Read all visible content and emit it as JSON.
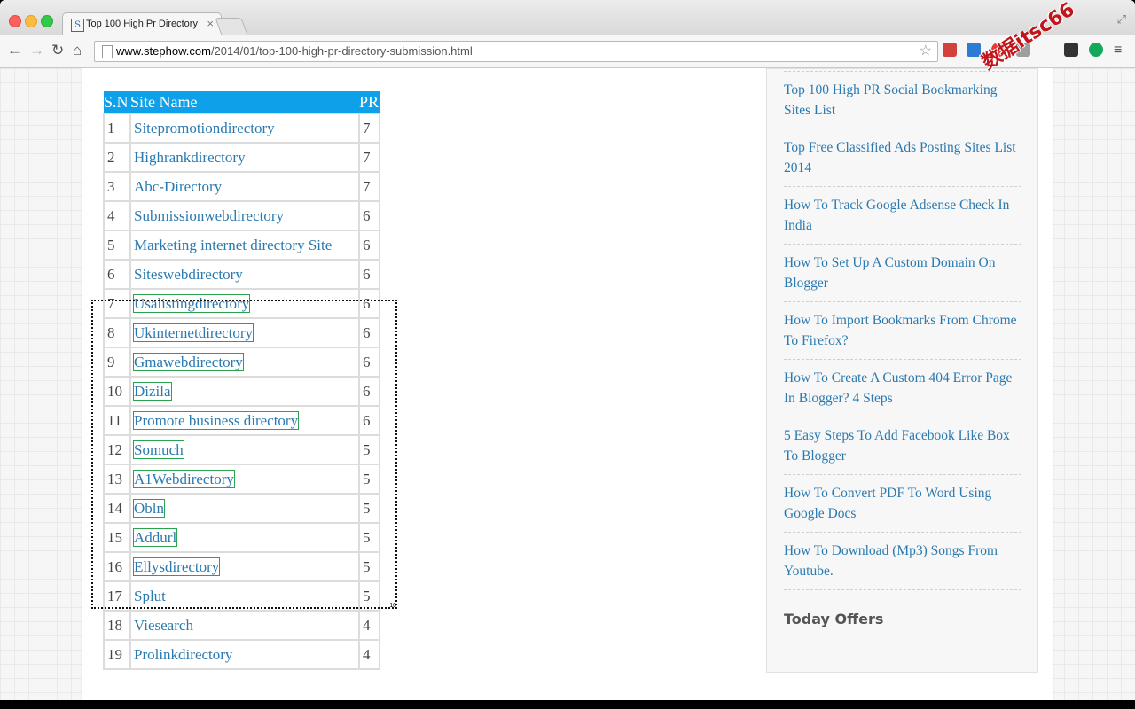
{
  "browser": {
    "tab_title": "Top 100 High Pr Directory",
    "tab_favicon_letter": "S",
    "url_host": "www.stephow.com",
    "url_path": "/2014/01/top-100-high-pr-directory-submission.html",
    "icons": {
      "back": "back-arrow-icon",
      "forward": "forward-arrow-icon",
      "reload": "reload-icon",
      "home": "home-icon",
      "star": "bookmark-star-icon",
      "menu": "hamburger-menu-icon"
    },
    "extensions": [
      {
        "name": "bookmark-ext-icon",
        "color": "#d2413a"
      },
      {
        "name": "c-ext-icon",
        "color": "#2d7bd3"
      },
      {
        "name": "opera-ext-icon",
        "color": "#e53935"
      },
      {
        "name": "download-ext-icon",
        "color": "#9e9e9e"
      },
      {
        "name": "mask-ext-icon",
        "color": "#333333"
      },
      {
        "name": "k-ext-icon",
        "color": "#14a85a"
      }
    ]
  },
  "table": {
    "headers": [
      "S.N",
      "Site Name",
      "PR"
    ],
    "rows": [
      {
        "sn": "1",
        "name": "Sitepromotiondirectory",
        "pr": "7"
      },
      {
        "sn": "2",
        "name": "Highrankdirectory",
        "pr": "7"
      },
      {
        "sn": "3",
        "name": "Abc-Directory",
        "pr": "7"
      },
      {
        "sn": "4",
        "name": "Submissionwebdirectory",
        "pr": "6"
      },
      {
        "sn": "5",
        "name": "Marketing internet directory Site",
        "pr": "6"
      },
      {
        "sn": "6",
        "name": "Siteswebdirectory",
        "pr": "6"
      },
      {
        "sn": "7",
        "name": "Usalistingdirectory",
        "pr": "6"
      },
      {
        "sn": "8",
        "name": "Ukinternetdirectory",
        "pr": "6"
      },
      {
        "sn": "9",
        "name": "Gmawebdirectory",
        "pr": "6"
      },
      {
        "sn": "10",
        "name": "Dizila",
        "pr": "6"
      },
      {
        "sn": "11",
        "name": "Promote business directory",
        "pr": "6"
      },
      {
        "sn": "12",
        "name": "Somuch",
        "pr": "5"
      },
      {
        "sn": "13",
        "name": "A1Webdirectory",
        "pr": "5"
      },
      {
        "sn": "14",
        "name": "Obln",
        "pr": "5"
      },
      {
        "sn": "15",
        "name": "Addurl",
        "pr": "5"
      },
      {
        "sn": "16",
        "name": "Ellysdirectory",
        "pr": "5"
      },
      {
        "sn": "17",
        "name": "Splut",
        "pr": "5"
      },
      {
        "sn": "18",
        "name": "Viesearch",
        "pr": "4"
      },
      {
        "sn": "19",
        "name": "Prolinkdirectory",
        "pr": "4"
      }
    ],
    "selection_count": "10"
  },
  "sidebar": {
    "items": [
      "Top 100 High PR Social Bookmarking Sites List",
      "Top Free Classified Ads Posting Sites List 2014",
      "How To Track Google Adsense Check In India",
      "How To Set Up A Custom Domain On Blogger",
      "How To Import Bookmarks From Chrome To Firefox?",
      "How To Create A Custom 404 Error Page In Blogger? 4 Steps",
      "5 Easy Steps To Add Facebook Like Box To Blogger",
      "How To Convert PDF To Word Using Google Docs",
      "How To Download (Mp3) Songs From Youtube."
    ],
    "section_title": "Today Offers"
  },
  "watermark": "数据itsc66"
}
